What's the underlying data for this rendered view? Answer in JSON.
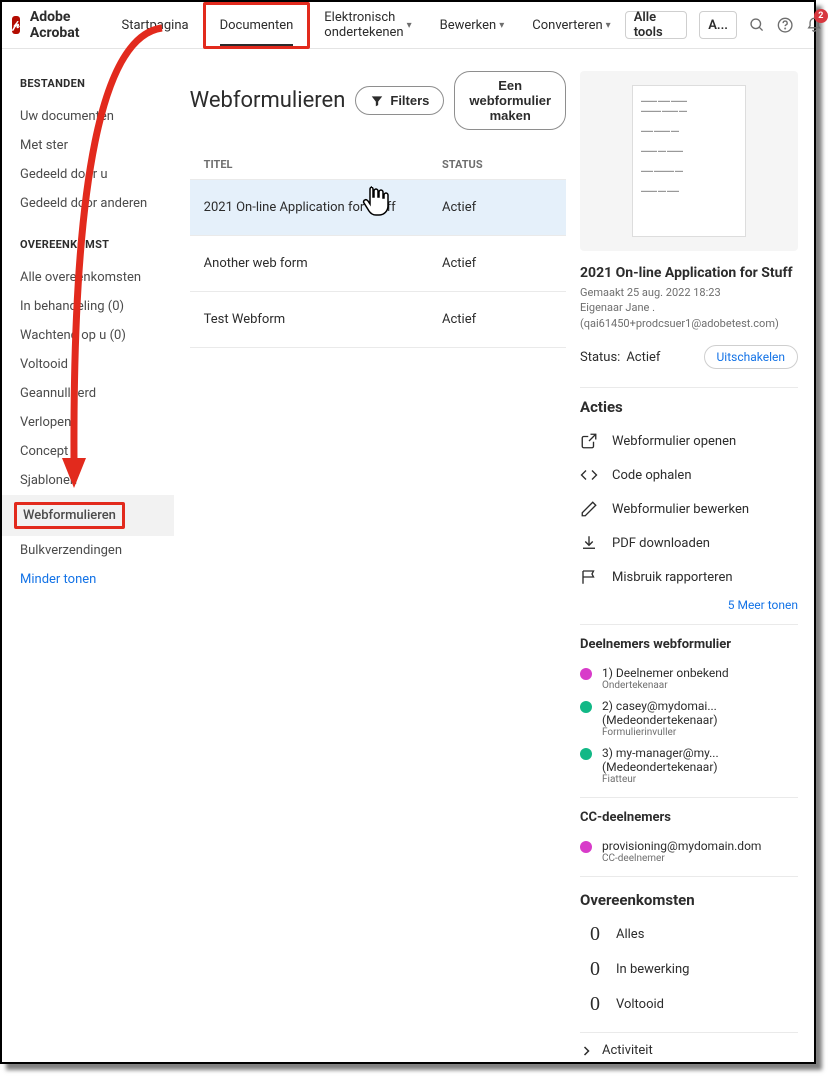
{
  "header": {
    "brand": "Adobe Acrobat",
    "nav": {
      "home": "Startpagina",
      "documents": "Documenten",
      "sign": "Elektronisch ondertekenen",
      "edit": "Bewerken",
      "convert": "Converteren",
      "alltools": "Alle tools",
      "profile": "A..."
    },
    "notif_count": "2"
  },
  "sidebar": {
    "group1": "BESTANDEN",
    "files": {
      "your_docs": "Uw documenten",
      "starred": "Met ster",
      "shared_by_you": "Gedeeld door u",
      "shared_by_others": "Gedeeld door anderen"
    },
    "group2": "OVEREENKOMST",
    "agreements": {
      "all": "Alle overeenkomsten",
      "in_progress": "In behandeling (0)",
      "waiting": "Wachtend op u (0)",
      "completed": "Voltooid",
      "cancelled": "Geannulleerd",
      "expired": "Verlopen",
      "draft": "Concept",
      "templates": "Sjablonen",
      "webforms": "Webformulieren",
      "bulk": "Bulkverzendingen"
    },
    "less": "Minder tonen"
  },
  "main": {
    "title": "Webformulieren",
    "filters_btn": "Filters",
    "create_btn": "Een webformulier maken",
    "col_title": "TITEL",
    "col_status": "STATUS",
    "rows": [
      {
        "title": "2021 On-line Application for Stuff",
        "status": "Actief"
      },
      {
        "title": "Another web form",
        "status": "Actief"
      },
      {
        "title": "Test Webform",
        "status": "Actief"
      }
    ]
  },
  "panel": {
    "doc_title": "2021 On-line Application for Stuff",
    "created": "Gemaakt 25 aug. 2022 18:23",
    "owner": "Eigenaar Jane .",
    "owner_email": "(qai61450+prodcsuer1@adobetest.com)",
    "status_label": "Status:",
    "status_value": "Actief",
    "disable_btn": "Uitschakelen",
    "actions_title": "Acties",
    "actions": {
      "open": "Webformulier openen",
      "code": "Code ophalen",
      "edit": "Webformulier bewerken",
      "download": "PDF downloaden",
      "report": "Misbruik rapporteren"
    },
    "more": "5 Meer tonen",
    "participants_title": "Deelnemers webformulier",
    "participants": [
      {
        "n": "1)",
        "name": "Deelnemer onbekend",
        "role": "Ondertekenaar",
        "color": "#d83bc9"
      },
      {
        "n": "2)",
        "name": "casey@mydomai...",
        "sub1": "(Medeondertekenaar)",
        "role": "Formulierinvuller",
        "color": "#12b886"
      },
      {
        "n": "3)",
        "name": "my-manager@my...",
        "sub1": "(Medeondertekenaar)",
        "role": "Fiatteur",
        "color": "#12b886"
      }
    ],
    "cc_title": "CC-deelnemers",
    "cc": {
      "name": "provisioning@mydomain.dom",
      "role": "CC-deelnemer",
      "color": "#d83bc9"
    },
    "agreements_title": "Overeenkomsten",
    "ag_rows": [
      {
        "n": "0",
        "label": "Alles"
      },
      {
        "n": "0",
        "label": "In bewerking"
      },
      {
        "n": "0",
        "label": "Voltooid"
      }
    ],
    "activity": "Activiteit"
  }
}
